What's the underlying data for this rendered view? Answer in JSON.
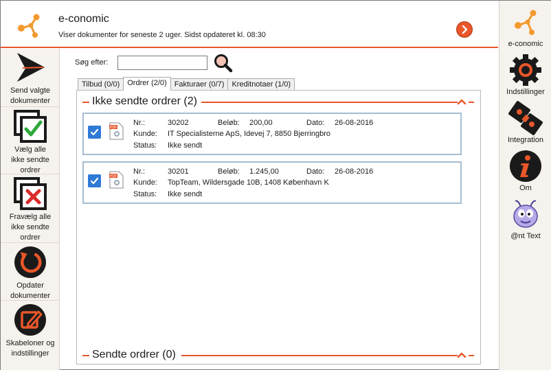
{
  "header": {
    "title": "e-conomic",
    "subtitle": "Viser dokumenter for seneste 2 uger. Sidst opdateret kl. 08:30"
  },
  "left_sidebar": [
    {
      "label_lines": [
        "Send valgte",
        "dokumenter"
      ]
    },
    {
      "label_lines": [
        "Vælg alle",
        "ikke sendte",
        "ordrer"
      ]
    },
    {
      "label_lines": [
        "Fravælg alle",
        "ikke sendte",
        "ordrer"
      ]
    },
    {
      "label_lines": [
        "Opdater",
        "dokumenter"
      ]
    },
    {
      "label_lines": [
        "Skabeloner og",
        "indstillinger"
      ]
    }
  ],
  "right_sidebar": [
    {
      "label": "e-conomic"
    },
    {
      "label": "Indstillinger"
    },
    {
      "label": "Integration"
    },
    {
      "label": "Om"
    },
    {
      "label": "@nt Text"
    }
  ],
  "search": {
    "label": "Søg efter:",
    "value": "",
    "placeholder": ""
  },
  "tabs": [
    {
      "label": "Tilbud (0/0)",
      "active": false
    },
    {
      "label": "Ordrer (2/0)",
      "active": true
    },
    {
      "label": "Fakturaer (0/7)",
      "active": false
    },
    {
      "label": "Kreditnotaer (1/0)",
      "active": false
    }
  ],
  "sections": {
    "unsent_title": "Ikke sendte ordrer (2)",
    "sent_title": "Sendte ordrer (0)"
  },
  "field_labels": {
    "nr": "Nr.:",
    "amount": "Beløb:",
    "date": "Dato:",
    "customer": "Kunde:",
    "status": "Status:"
  },
  "orders": [
    {
      "checked": true,
      "nr": "30202",
      "amount": "200,00",
      "date": "26-08-2016",
      "customer": "IT Specialisterne ApS, Idevej 7, 8850 Bjerringbro",
      "status": "Ikke sendt"
    },
    {
      "checked": true,
      "nr": "30201",
      "amount": "1.245,00",
      "date": "26-08-2016",
      "customer": "TopTeam, Wildersgade 10B, 1408 København K",
      "status": "Ikke sendt"
    }
  ],
  "colors": {
    "accent": "#e8562a",
    "checkbox": "#2f7ad6",
    "sidebar_bg": "#f6f2ee",
    "card_border": "#a5bccf"
  }
}
